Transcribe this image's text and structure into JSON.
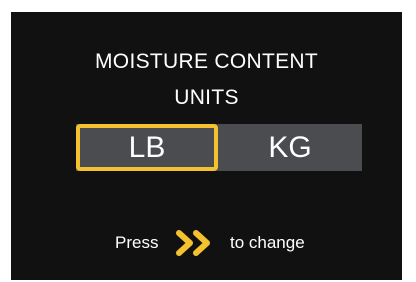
{
  "screen": {
    "title_line1": "MOISTURE CONTENT",
    "title_line2": "UNITS",
    "options": [
      {
        "label": "LB",
        "selected": true
      },
      {
        "label": "KG",
        "selected": false
      }
    ],
    "hint": {
      "prefix": "Press",
      "icon": "double-chevron-right-icon",
      "suffix": "to change"
    }
  },
  "colors": {
    "background": "#111111",
    "selection_border": "#f4c22e",
    "toggle_background": "#4a4c4f",
    "text": "#ffffff"
  }
}
